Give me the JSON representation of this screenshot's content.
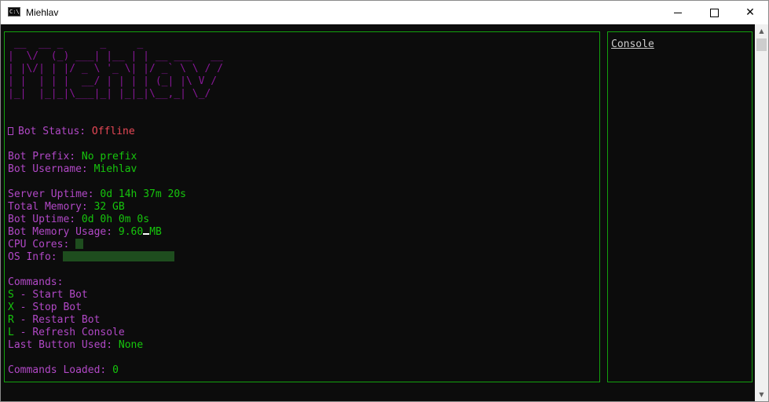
{
  "window": {
    "title": "Miehlav",
    "app_icon_text": "C:\\",
    "minimize_icon": "minimize-icon",
    "maximize_icon": "maximize-icon",
    "close_glyph": "✕"
  },
  "logo_art": " __  __ _      _     _\n|  \\/  (_) ___| |__ | | __ ___   __\n| |\\/| | |/ _ \\ '_ \\| |/ _` \\ \\ / /\n| |  | | |  __/ | | | | (_| |\\ V /\n|_|  |_|_|\\___|_| |_|_|\\__,_| \\_/",
  "status": {
    "label": "Bot Status: ",
    "value": "Offline"
  },
  "prefix": {
    "label": "Bot Prefix: ",
    "value": "No prefix"
  },
  "username": {
    "label": "Bot Username: ",
    "value": "Miehlav"
  },
  "server_uptime": {
    "label": "Server Uptime: ",
    "value": "0d 14h 37m 20s"
  },
  "total_memory": {
    "label": "Total Memory: ",
    "value": "32 GB"
  },
  "bot_uptime": {
    "label": "Bot Uptime: ",
    "value": "0d 0h 0m 0s"
  },
  "memory_usage": {
    "label": "Bot Memory Usage: ",
    "value_a": "9.60",
    "value_b": "MB"
  },
  "cpu_cores": {
    "label": "CPU Cores: "
  },
  "os_info": {
    "label": "OS Info: "
  },
  "commands": {
    "header": "Commands:",
    "items": [
      {
        "key": "S",
        "sep": " - ",
        "desc": "Start Bot"
      },
      {
        "key": "X",
        "sep": " - ",
        "desc": "Stop Bot"
      },
      {
        "key": "R",
        "sep": " - ",
        "desc": "Restart Bot"
      },
      {
        "key": "L",
        "sep": " - ",
        "desc": "Refresh Console"
      }
    ]
  },
  "last_button": {
    "label": "Last Button Used: ",
    "value": "None"
  },
  "commands_loaded": {
    "label": "Commands Loaded: ",
    "value": "0"
  },
  "side_panel": {
    "title": "Console"
  },
  "scrollbar": {
    "up": "▲",
    "down": "▼"
  },
  "colors": {
    "purple": "#b148c6",
    "green": "#16c60c",
    "red": "#e74856",
    "border": "#13a10e",
    "background": "#0c0c0c"
  }
}
